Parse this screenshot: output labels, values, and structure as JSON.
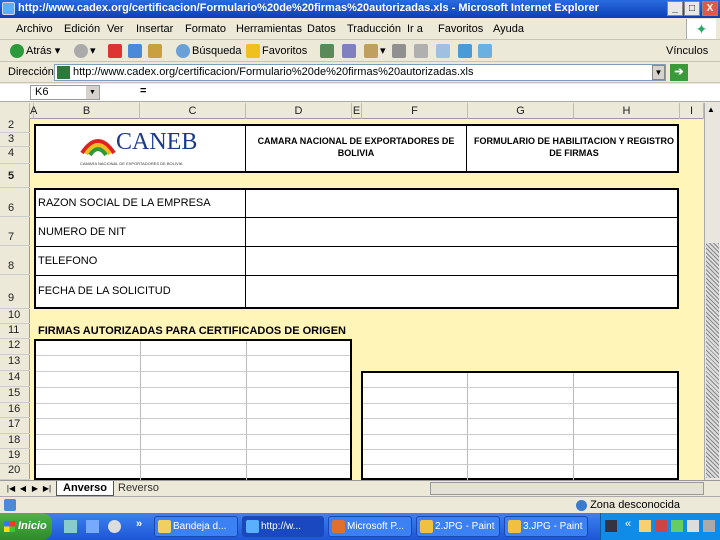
{
  "window": {
    "title": "http://www.cadex.org/certificacion/Formulario%20de%20firmas%20autorizadas.xls - Microsoft Internet Explorer",
    "min": "_",
    "max": "□",
    "close": "X"
  },
  "menubar": [
    "Archivo",
    "Edición",
    "Ver",
    "Insertar",
    "Formato",
    "Herramientas",
    "Datos",
    "Traducción",
    "Ir a",
    "Favoritos",
    "Ayuda"
  ],
  "toolbar": {
    "back": "Atrás",
    "search": "Búsqueda",
    "favorites": "Favoritos",
    "links": "Vínculos"
  },
  "address": {
    "label": "Dirección",
    "url": "http://www.cadex.org/certificacion/Formulario%20de%20firmas%20autorizadas.xls"
  },
  "formula": {
    "namebox": "K6",
    "fx": "="
  },
  "columns": [
    "A",
    "B",
    "C",
    "D",
    "E",
    "F",
    "G",
    "H",
    "I"
  ],
  "rows": [
    "2",
    "3",
    "4",
    "5",
    "6",
    "7",
    "8",
    "9",
    "10",
    "11",
    "12",
    "13",
    "14",
    "15",
    "16",
    "17",
    "18",
    "19",
    "20"
  ],
  "sheet": {
    "logo_text": "CANEB",
    "logo_subtitle": "CAMARA NACIONAL DE EXPORTADORES DE BOLIVIA",
    "header_middle": "CAMARA NACIONAL DE EXPORTADORES DE BOLIVIA",
    "header_right": "FORMULARIO DE HABILITACION Y REGISTRO DE FIRMAS",
    "fields": [
      "RAZON SOCIAL DE LA EMPRESA",
      "NUMERO DE NIT",
      "TELEFONO",
      "FECHA DE LA SOLICITUD"
    ],
    "section_title": "FIRMAS AUTORIZADAS PARA CERTIFICADOS DE ORIGEN"
  },
  "tabs": {
    "active": "Anverso",
    "other": "Reverso"
  },
  "status": {
    "zone": "Zona desconocida"
  },
  "taskbar": {
    "start": "Inicio",
    "items": [
      "Bandeja d...",
      "http://w...",
      "Microsoft P...",
      "2.JPG - Paint",
      "3.JPG - Paint"
    ]
  }
}
